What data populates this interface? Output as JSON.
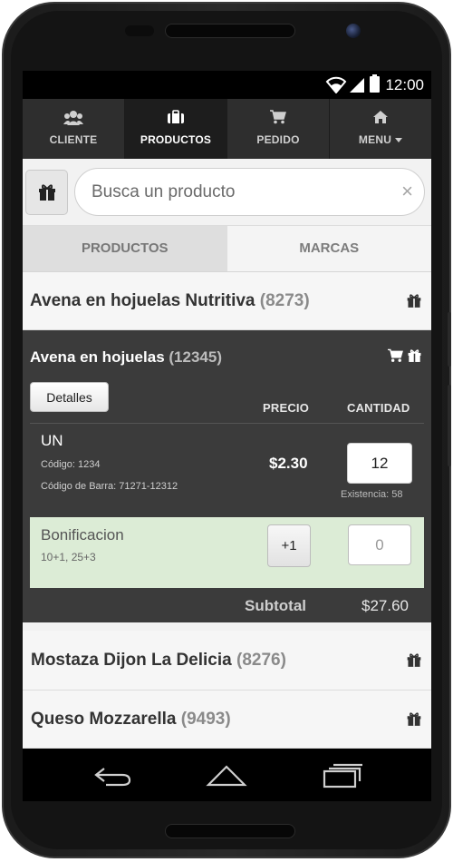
{
  "status_bar": {
    "time": "12:00"
  },
  "nav": {
    "items": [
      {
        "label": "CLIENTE",
        "icon": "users-icon",
        "active": false
      },
      {
        "label": "PRODUCTOS",
        "icon": "briefcase-icon",
        "active": true
      },
      {
        "label": "PEDIDO",
        "icon": "cart-icon",
        "active": false
      },
      {
        "label": "MENU",
        "icon": "home-icon",
        "active": false
      }
    ]
  },
  "search": {
    "placeholder": "Busca un producto",
    "clear_label": "×"
  },
  "tabs": [
    {
      "label": "PRODUCTOS",
      "active": true
    },
    {
      "label": "MARCAS",
      "active": false
    }
  ],
  "products": {
    "first": {
      "name": "Avena en hojuelas Nutritiva",
      "code": "(8273)"
    },
    "expanded": {
      "name": "Avena en hojuelas",
      "code": "(12345)",
      "details_label": "Detalles",
      "col_price": "PRECIO",
      "col_qty": "CANTIDAD",
      "unit": "UN",
      "code_line": "Código: 1234",
      "barcode_line": "Código de Barra: 71271-12312",
      "price": "$2.30",
      "qty": "12",
      "stock": "Existencia: 58",
      "bonus": {
        "title": "Bonificacion",
        "rules": "10+1, 25+3",
        "plus_label": "+1",
        "qty": "0"
      },
      "subtotal_label": "Subtotal",
      "subtotal_value": "$27.60"
    },
    "list": [
      {
        "name": "Mostaza Dijon La Delicia",
        "code": "(8276)"
      },
      {
        "name": "Queso Mozzarella",
        "code": "(9493)"
      }
    ]
  },
  "colors": {
    "navbar": "#2e2e2e",
    "expanded_bg": "#3b3b3b",
    "bonus_bg": "#dcecd6"
  }
}
